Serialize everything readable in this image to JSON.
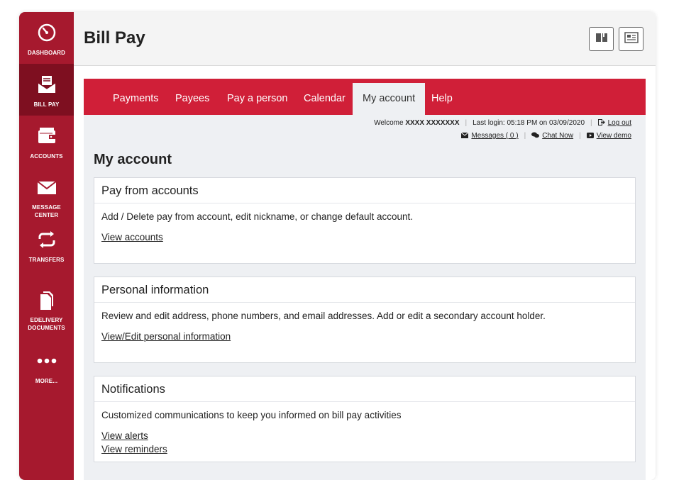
{
  "sidebar": {
    "items": [
      {
        "label": "DASHBOARD",
        "icon": "gauge-icon"
      },
      {
        "label": "BILL PAY",
        "icon": "bill-envelope-icon",
        "active": true
      },
      {
        "label": "ACCOUNTS",
        "icon": "wallet-icon"
      },
      {
        "label": "MESSAGE CENTER",
        "icon": "envelope-icon"
      },
      {
        "label": "TRANSFERS",
        "icon": "transfer-arrows-icon"
      },
      {
        "label": "EDELIVERY DOCUMENTS",
        "icon": "documents-icon"
      },
      {
        "label": "MORE...",
        "icon": "ellipsis-icon"
      }
    ]
  },
  "header": {
    "title": "Bill Pay"
  },
  "tabs": [
    {
      "label": "Payments"
    },
    {
      "label": "Payees"
    },
    {
      "label": "Pay a person"
    },
    {
      "label": "Calendar"
    },
    {
      "label": "My account",
      "active": true
    },
    {
      "label": "Help"
    }
  ],
  "status": {
    "welcome_prefix": "Welcome",
    "user": "XXXX XXXXXXX",
    "last_login": "Last login: 05:18 PM on 03/09/2020",
    "logout": "Log out",
    "messages": "Messages ( 0 )",
    "chat": "Chat Now",
    "demo": "View demo"
  },
  "main": {
    "section_title": "My account",
    "cards": [
      {
        "title": "Pay from accounts",
        "desc": "Add / Delete pay from account, edit nickname, or change default account.",
        "links": [
          "View accounts"
        ]
      },
      {
        "title": "Personal information",
        "desc": "Review and edit address, phone numbers, and email addresses. Add or edit a secondary account holder.",
        "links": [
          "View/Edit personal information"
        ]
      },
      {
        "title": "Notifications",
        "desc": "Customized communications to keep you informed on bill pay activities",
        "links": [
          "View alerts",
          "View reminders"
        ]
      }
    ]
  },
  "colors": {
    "sidebar": "#a6192e",
    "sidebar_active": "#7e0f20",
    "tabbar": "#d01f38"
  }
}
